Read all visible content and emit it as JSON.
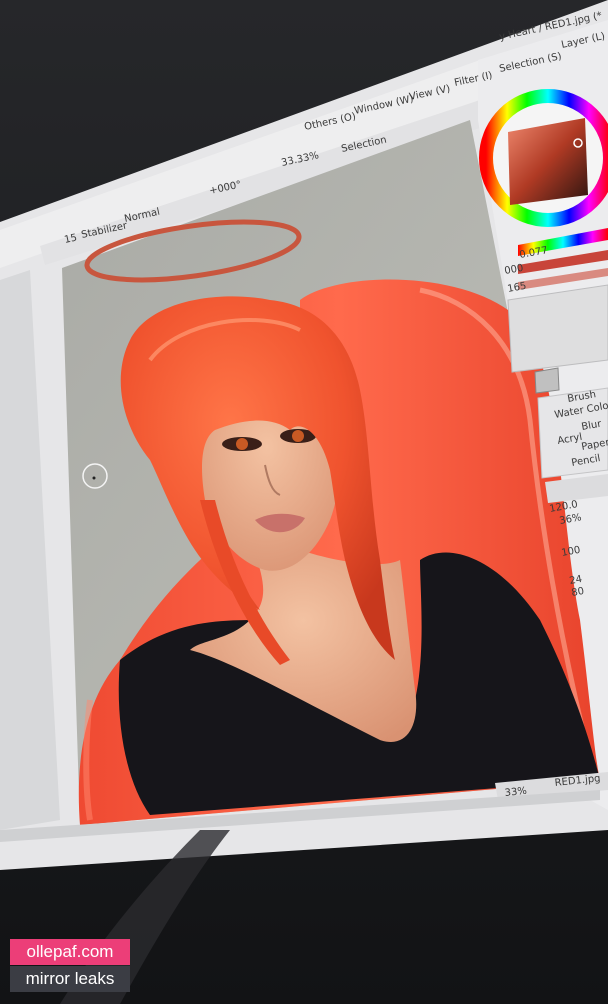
{
  "screen": {
    "title_fragment": "y Heart / RED1.jpg (*",
    "menu": {
      "layer": "Layer (L)",
      "selection": "Selection (S)",
      "filter": "Filter (I)",
      "view": "View (V)",
      "window": "Window (W)",
      "others": "Others (O)"
    },
    "toolbar": {
      "selection_check": "Selection",
      "zoom": "33.33%",
      "zoom2": "+000°",
      "blend_mode": "Normal",
      "stabilizer_label": "Stabilizer",
      "stabilizer_value": "15"
    },
    "side_values": {
      "v1": "0.077",
      "v2": "000",
      "v3": "165",
      "size": "120.0",
      "percent": "36%",
      "n1": "100",
      "n2": "24",
      "n3": "80"
    },
    "brushes": [
      "Brush",
      "Water Color",
      "Blur",
      "Acryl",
      "Paper",
      "Pencil"
    ],
    "status": {
      "file": "RED1.jpg",
      "zoom": "33%"
    }
  },
  "watermark": {
    "site": "ollepaf.com",
    "tagline": "mirror leaks"
  },
  "colors": {
    "bezel": "#1c1d20",
    "hair": "#f0532e",
    "chair": "#ff5a3c",
    "canvas_bg": "#b2b3ad",
    "ui": "#e8e8ea",
    "watermark_pink": "#ec3e78"
  }
}
